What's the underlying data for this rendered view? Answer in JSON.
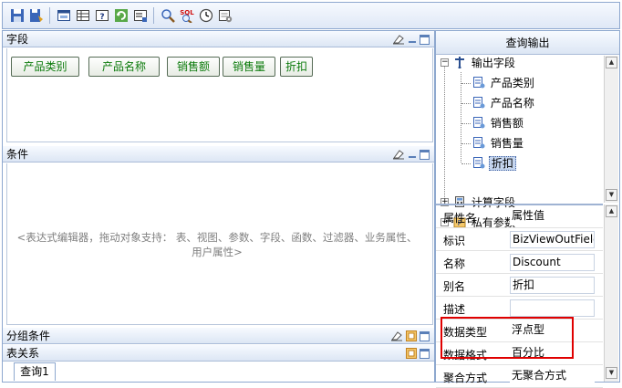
{
  "fields_panel": {
    "title": "字段",
    "fields": [
      "产品类别",
      "产品名称",
      "销售额",
      "销售量",
      "折扣"
    ]
  },
  "condition_panel": {
    "title": "条件",
    "placeholder_line1": "<表达式编辑器，拖动对象支持：   表、视图、参数、字段、函数、过滤器、业务属性、",
    "placeholder_line2": "用户属性>"
  },
  "group_panel": {
    "title": "分组条件"
  },
  "relation_panel": {
    "title": "表关系",
    "tab": "查询1"
  },
  "query_output": {
    "title": "查询输出",
    "root": "输出字段",
    "children": [
      "产品类别",
      "产品名称",
      "销售额",
      "销售量",
      "折扣"
    ],
    "selected": "折扣",
    "computed": "计算字段",
    "private_params": "私有参数"
  },
  "properties": {
    "header_name": "属性名",
    "header_value": "属性值",
    "rows": [
      {
        "name": "标识",
        "value": "BizViewOutField"
      },
      {
        "name": "名称",
        "value": "Discount"
      },
      {
        "name": "别名",
        "value": "折扣"
      },
      {
        "name": "描述",
        "value": ""
      },
      {
        "name": "数据类型",
        "value": "浮点型"
      },
      {
        "name": "数据格式",
        "value": "百分比"
      },
      {
        "name": "聚合方式",
        "value": "无聚合方式"
      }
    ]
  },
  "colors": {
    "accent_border": "#8ea8cf",
    "highlight_red": "#e00000",
    "field_text": "#0b7a0b"
  },
  "toolbar_icons": [
    "save-icon",
    "save-as-icon",
    "window-icon",
    "table-icon",
    "help-icon",
    "refresh-icon",
    "export-icon",
    "search-icon",
    "sql-icon",
    "clock-icon",
    "settings-icon"
  ]
}
